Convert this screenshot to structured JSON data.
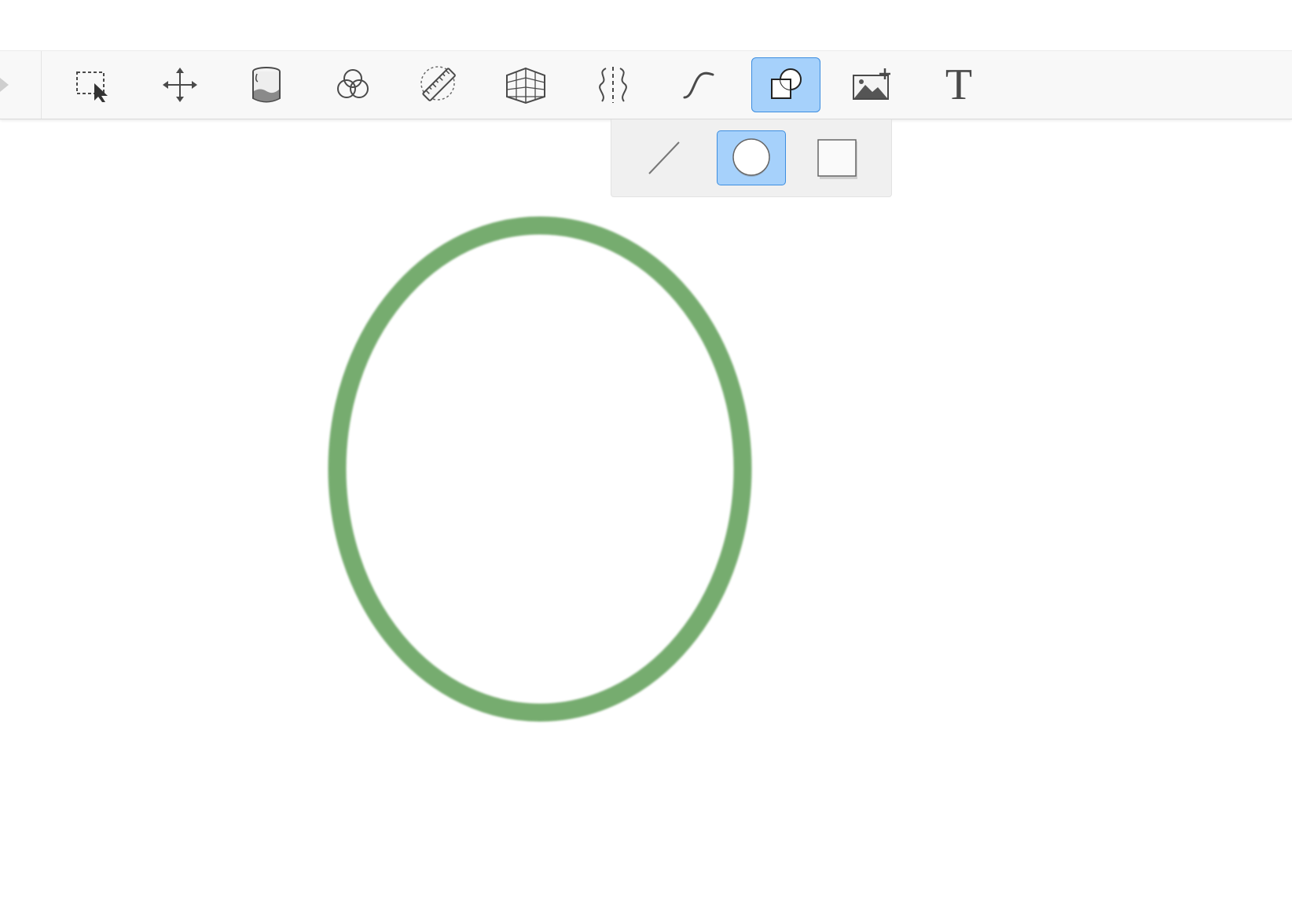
{
  "toolbar": {
    "tools": [
      {
        "name": "selection",
        "icon": "marquee-select-icon",
        "active": false
      },
      {
        "name": "transform",
        "icon": "move-arrows-icon",
        "active": false
      },
      {
        "name": "fill",
        "icon": "paint-bucket-icon",
        "active": false
      },
      {
        "name": "blend",
        "icon": "color-circles-icon",
        "active": false
      },
      {
        "name": "ruler",
        "icon": "ruler-icon",
        "active": false
      },
      {
        "name": "perspective",
        "icon": "perspective-grid-icon",
        "active": false
      },
      {
        "name": "symmetry",
        "icon": "symmetry-icon",
        "active": false
      },
      {
        "name": "stroke",
        "icon": "curve-icon",
        "active": false
      },
      {
        "name": "shapes",
        "icon": "shapes-icon",
        "active": true
      },
      {
        "name": "import-image",
        "icon": "add-image-icon",
        "active": false
      },
      {
        "name": "text",
        "icon": "text-icon",
        "active": false
      }
    ],
    "text_tool_glyph": "T"
  },
  "shape_flyout": {
    "items": [
      {
        "name": "line",
        "icon": "line-icon",
        "active": false
      },
      {
        "name": "ellipse",
        "icon": "ellipse-icon",
        "active": true
      },
      {
        "name": "rectangle",
        "icon": "rectangle-icon",
        "active": false
      }
    ]
  },
  "canvas": {
    "shape": "ellipse",
    "stroke_color": "#5f9e57"
  },
  "colors": {
    "active_fill": "#a6d1fb",
    "active_border": "#3d8ee0",
    "icon": "#4a4a4a"
  }
}
